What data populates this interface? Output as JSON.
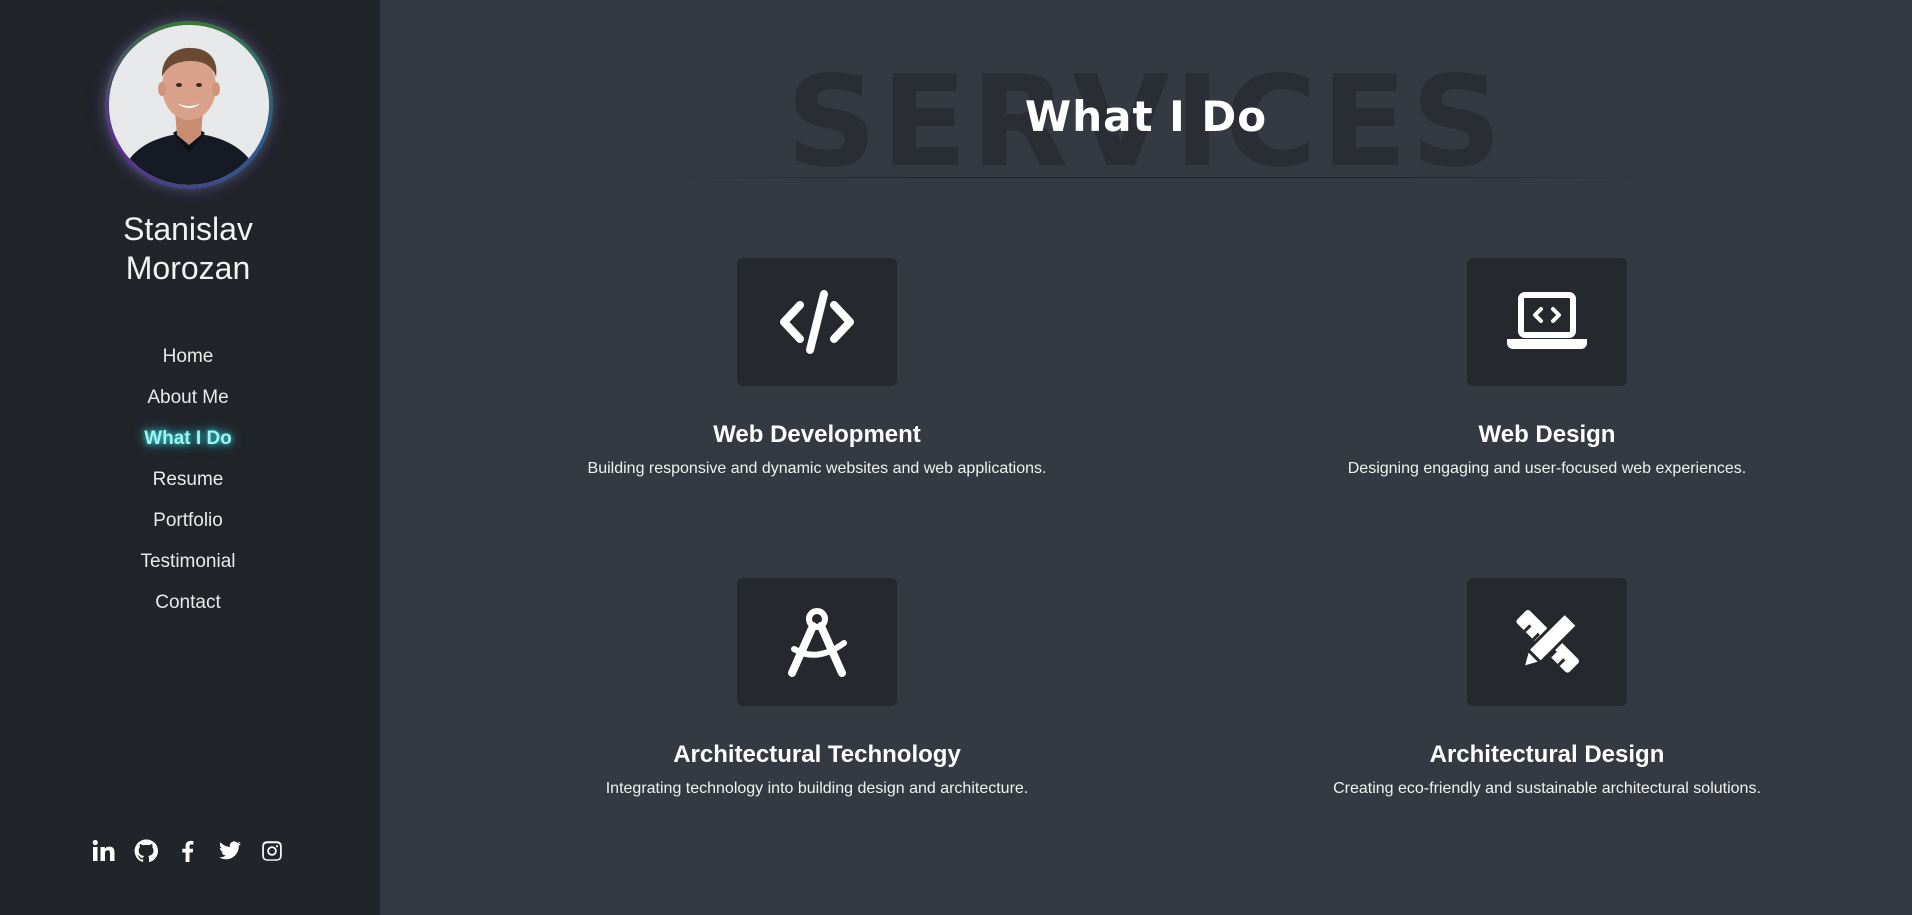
{
  "profile": {
    "name_line1": "Stanislav",
    "name_line2": "Morozan"
  },
  "nav": {
    "items": [
      {
        "label": "Home"
      },
      {
        "label": "About Me"
      },
      {
        "label": "What I Do",
        "active": true
      },
      {
        "label": "Resume"
      },
      {
        "label": "Portfolio"
      },
      {
        "label": "Testimonial"
      },
      {
        "label": "Contact"
      }
    ]
  },
  "socials": [
    {
      "icon": "linkedin-icon"
    },
    {
      "icon": "github-icon"
    },
    {
      "icon": "facebook-icon"
    },
    {
      "icon": "twitter-icon"
    },
    {
      "icon": "instagram-icon"
    }
  ],
  "section": {
    "background_title": "SERVICES",
    "title": "What I Do"
  },
  "services": [
    {
      "icon": "code-icon",
      "title": "Web Development",
      "description": "Building responsive and dynamic websites and web applications."
    },
    {
      "icon": "laptop-code-icon",
      "title": "Web Design",
      "description": "Designing engaging and user-focused web experiences."
    },
    {
      "icon": "compass-drafting-icon",
      "title": "Architectural Technology",
      "description": "Integrating technology into building design and architecture."
    },
    {
      "icon": "pencil-ruler-icon",
      "title": "Architectural Design",
      "description": "Creating eco-friendly and sustainable architectural solutions."
    }
  ],
  "colors": {
    "sidebar_bg": "#212428",
    "main_bg": "#353a42",
    "icon_box_bg": "#25282d",
    "active_nav": "#9ff5f0"
  }
}
